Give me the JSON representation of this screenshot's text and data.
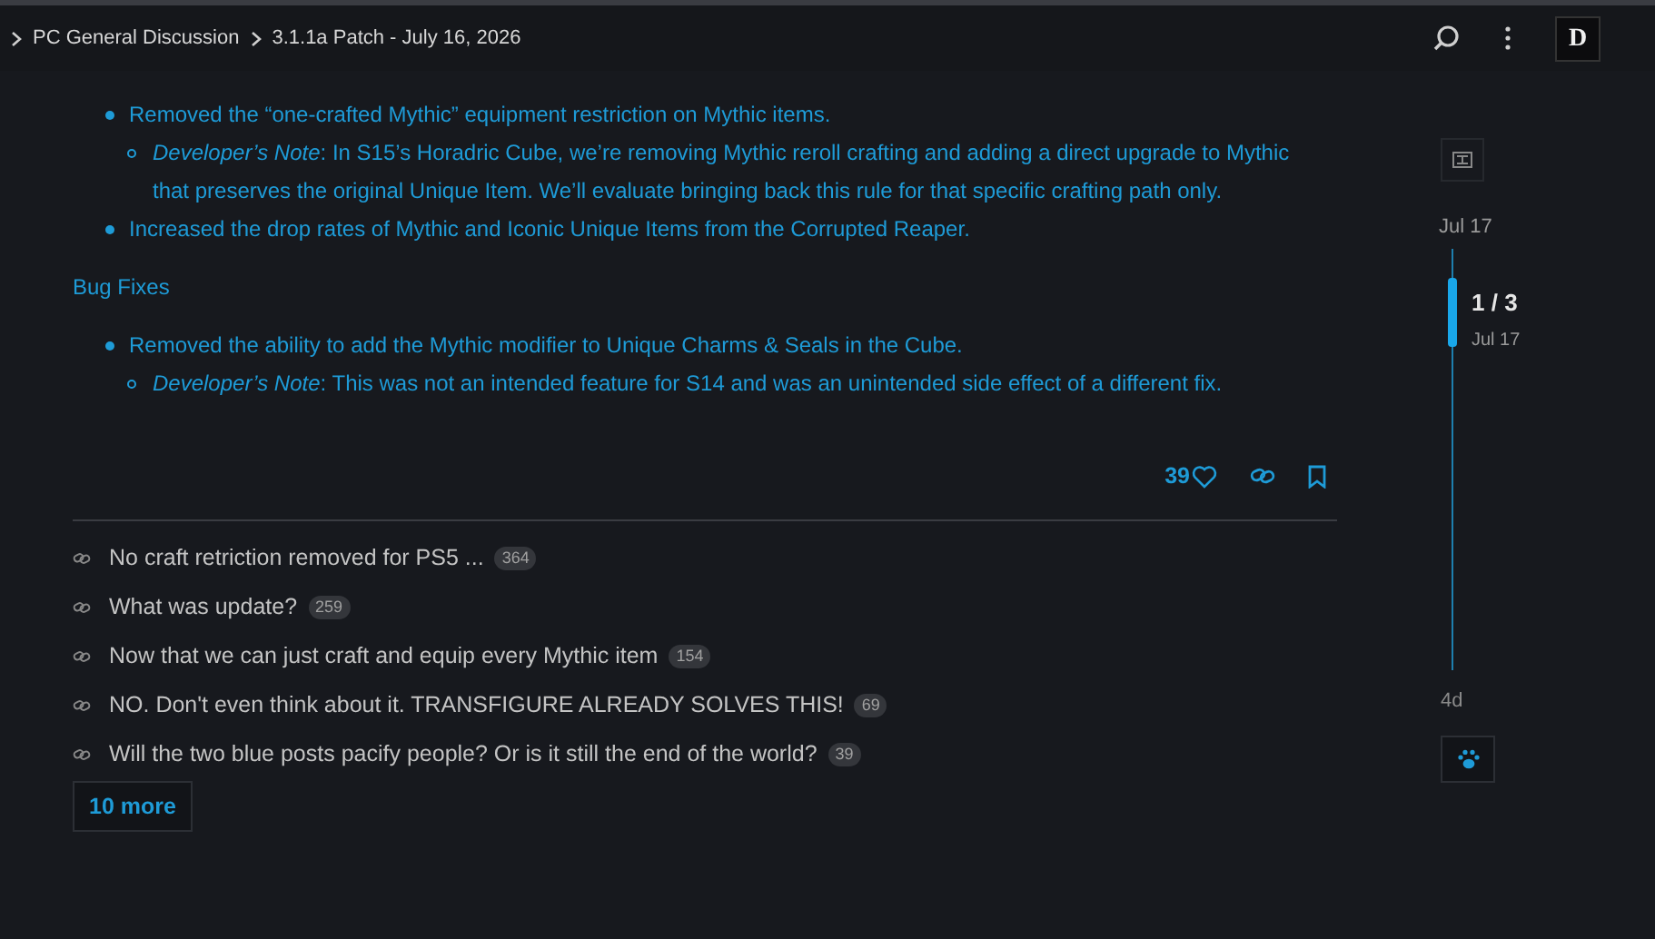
{
  "breadcrumbs": [
    "PC General Discussion",
    "3.1.1a Patch - July 16, 2026"
  ],
  "header": {
    "avatar_letter": "D"
  },
  "post": {
    "blocks": [
      {
        "kind": "bullet",
        "text": "Removed the “one-crafted Mythic” equipment restriction on Mythic items.",
        "children": [
          {
            "kind": "note",
            "text": "*Developer’s Note*: In S15’s Horadric Cube, we’re removing Mythic reroll crafting and adding a direct upgrade to Mythic that preserves the original Unique Item. We’ll evaluate bringing back this rule for that specific crafting path only."
          }
        ]
      },
      {
        "kind": "bullet",
        "text": "Increased the drop rates of Mythic and Iconic Unique Items from the Corrupted Reaper."
      },
      {
        "kind": "heading",
        "text": "Bug Fixes"
      },
      {
        "kind": "bullet",
        "text": "Removed the ability to add the Mythic modifier to Unique Charms & Seals in the Cube.",
        "children": [
          {
            "kind": "note",
            "text": "*Developer’s Note*: This was not an intended feature for S14 and was an unintended side effect of a different fix."
          }
        ]
      }
    ],
    "likes": "39"
  },
  "links": [
    {
      "title": "No craft retriction removed for PS5 ...",
      "count": "364"
    },
    {
      "title": "What was update?",
      "count": "259"
    },
    {
      "title": "Now that we can just craft and equip every Mythic item",
      "count": "154"
    },
    {
      "title": "NO. Don't even think about it. TRANSFIGURE ALREADY SOLVES THIS!",
      "count": "69"
    },
    {
      "title": "Will the two blue posts pacify people? Or is it still the end of the world?",
      "count": "39"
    }
  ],
  "more_button": "10 more",
  "timeline": {
    "start_date": "Jul 17",
    "position": "1 / 3",
    "position_date": "Jul 17",
    "end_label": "4d"
  }
}
